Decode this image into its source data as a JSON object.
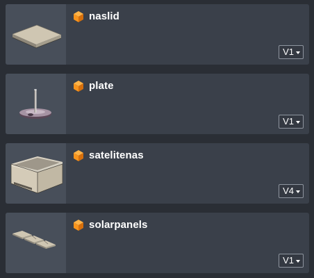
{
  "items": [
    {
      "name": "naslid",
      "version": "V1",
      "thumbnail": "flat-lid-model"
    },
    {
      "name": "plate",
      "version": "V1",
      "thumbnail": "plate-with-rod-model"
    },
    {
      "name": "satelitenas",
      "version": "V4",
      "thumbnail": "open-box-model"
    },
    {
      "name": "solarpanels",
      "version": "V1",
      "thumbnail": "solar-panels-model"
    }
  ],
  "colors": {
    "card_bg": "#3a404a",
    "thumb_bg": "#484f5a",
    "page_bg": "#2a2e35",
    "cube_accent": "#f7941d"
  },
  "icons": {
    "item_type": "orange-cube-icon",
    "version_dropdown": "chevron-down-icon"
  }
}
